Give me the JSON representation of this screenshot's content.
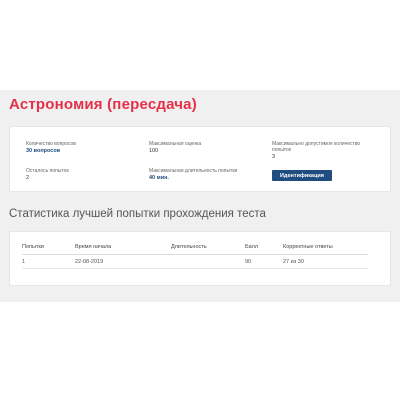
{
  "test": {
    "title": "Астрономия (пересдача)"
  },
  "info": {
    "questions_count_label": "Количество вопросов",
    "questions_count_value": "30 вопросов",
    "max_score_label": "Максимальная оценка",
    "max_score_value": "100",
    "max_attempts_label_line1": "Максимально допустимое количество",
    "max_attempts_label_line2": "попыток",
    "max_attempts_value": "3",
    "attempts_left_label": "Осталось попыток",
    "attempts_left_value": "2",
    "max_duration_label": "Максимальная длительность попытки",
    "max_duration_value": "40 мин.",
    "identification_button": "Идентификация"
  },
  "stats": {
    "heading": "Статистика лучшей попытки прохождения теста",
    "columns": [
      "Попытки",
      "Время начала",
      "Длительность",
      "Балл",
      "Корректные ответы"
    ],
    "rows": [
      {
        "attempt": "1",
        "start_time": "22-08-2019",
        "duration": "",
        "score": "90",
        "correct": "27 из 30"
      }
    ]
  },
  "colors": {
    "title": "#e5304a",
    "button": "#1f4d80",
    "accent_value": "#1e4d7b"
  }
}
